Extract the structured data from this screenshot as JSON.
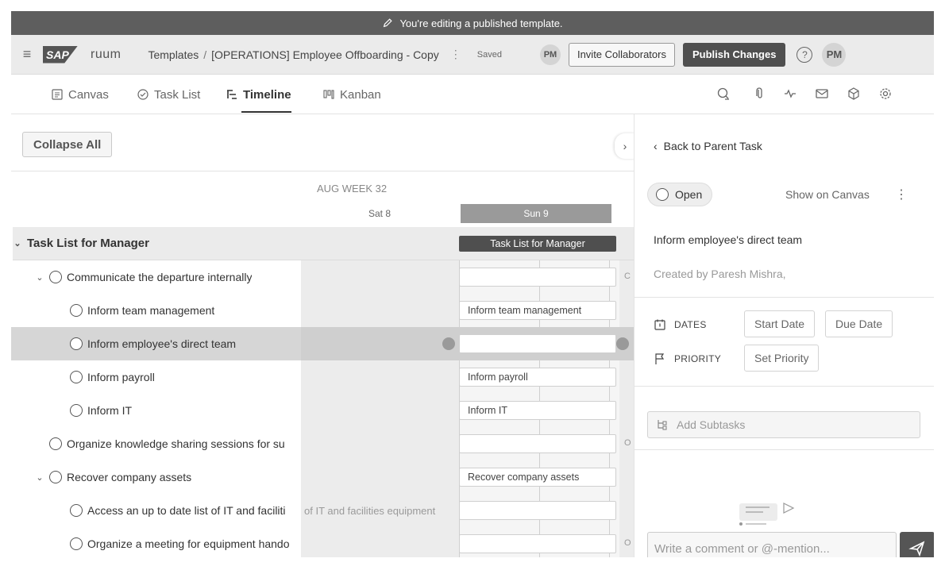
{
  "banner": {
    "text": "You're editing a published template.",
    "icon": "pencil-icon"
  },
  "header": {
    "logo": "SAP",
    "product": "ruum",
    "breadcrumb_root": "Templates",
    "breadcrumb_sep": "/",
    "breadcrumb_current": "[OPERATIONS] Employee Offboarding - Copy",
    "save_status": "Saved",
    "collaborator_initials": "PM",
    "invite_label": "Invite Collaborators",
    "publish_label": "Publish Changes",
    "help_label": "?",
    "user_initials": "PM"
  },
  "views": {
    "tabs": [
      {
        "label": "Canvas",
        "icon": "document-icon",
        "active": false
      },
      {
        "label": "Task List",
        "icon": "check-circle-icon",
        "active": false
      },
      {
        "label": "Timeline",
        "icon": "timeline-icon",
        "active": true
      },
      {
        "label": "Kanban",
        "icon": "kanban-icon",
        "active": false
      }
    ],
    "tools": [
      "comments-icon",
      "attachment-icon",
      "activity-icon",
      "mail-icon",
      "package-icon",
      "settings-icon"
    ]
  },
  "toolbar": {
    "collapse_label": "Collapse All"
  },
  "timeline": {
    "week": "AUG WEEK 32",
    "days": [
      "Sat 8",
      "Sun 9"
    ]
  },
  "tasks": [
    {
      "label": "Task List for Manager",
      "type": "section",
      "bar": "Task List for Manager"
    },
    {
      "label": "Communicate the departure internally",
      "level": 1,
      "chevron": true,
      "bar": "",
      "side": "C"
    },
    {
      "label": "Inform team management",
      "level": 2,
      "bar": "Inform team management"
    },
    {
      "label": "Inform employee's direct team",
      "level": 2,
      "bar": "",
      "selected": true
    },
    {
      "label": "Inform payroll",
      "level": 2,
      "bar": "Inform payroll"
    },
    {
      "label": "Inform IT",
      "level": 2,
      "bar": "Inform IT"
    },
    {
      "label": "Organize knowledge sharing sessions for su",
      "level": 1,
      "bar": "",
      "side": "O"
    },
    {
      "label": "Recover company assets",
      "level": 1,
      "chevron": true,
      "bar": "Recover company assets"
    },
    {
      "label": "Access an up to date list of IT and faciliti",
      "level": 2,
      "bar": "",
      "overflow": "of IT and facilities equipment"
    },
    {
      "label": "Organize a meeting for equipment hando",
      "level": 2,
      "bar": "",
      "side": "O"
    }
  ],
  "details": {
    "back_label": "Back to Parent Task",
    "status": "Open",
    "show_on_canvas": "Show on Canvas",
    "task_title": "Inform employee's direct team",
    "created_by": "Created by Paresh Mishra,",
    "dates_label": "DATES",
    "start_date": "Start Date",
    "due_date": "Due Date",
    "priority_label": "PRIORITY",
    "set_priority": "Set Priority",
    "add_subtasks": "Add Subtasks",
    "comment_placeholder": "Write a comment or @-mention..."
  }
}
